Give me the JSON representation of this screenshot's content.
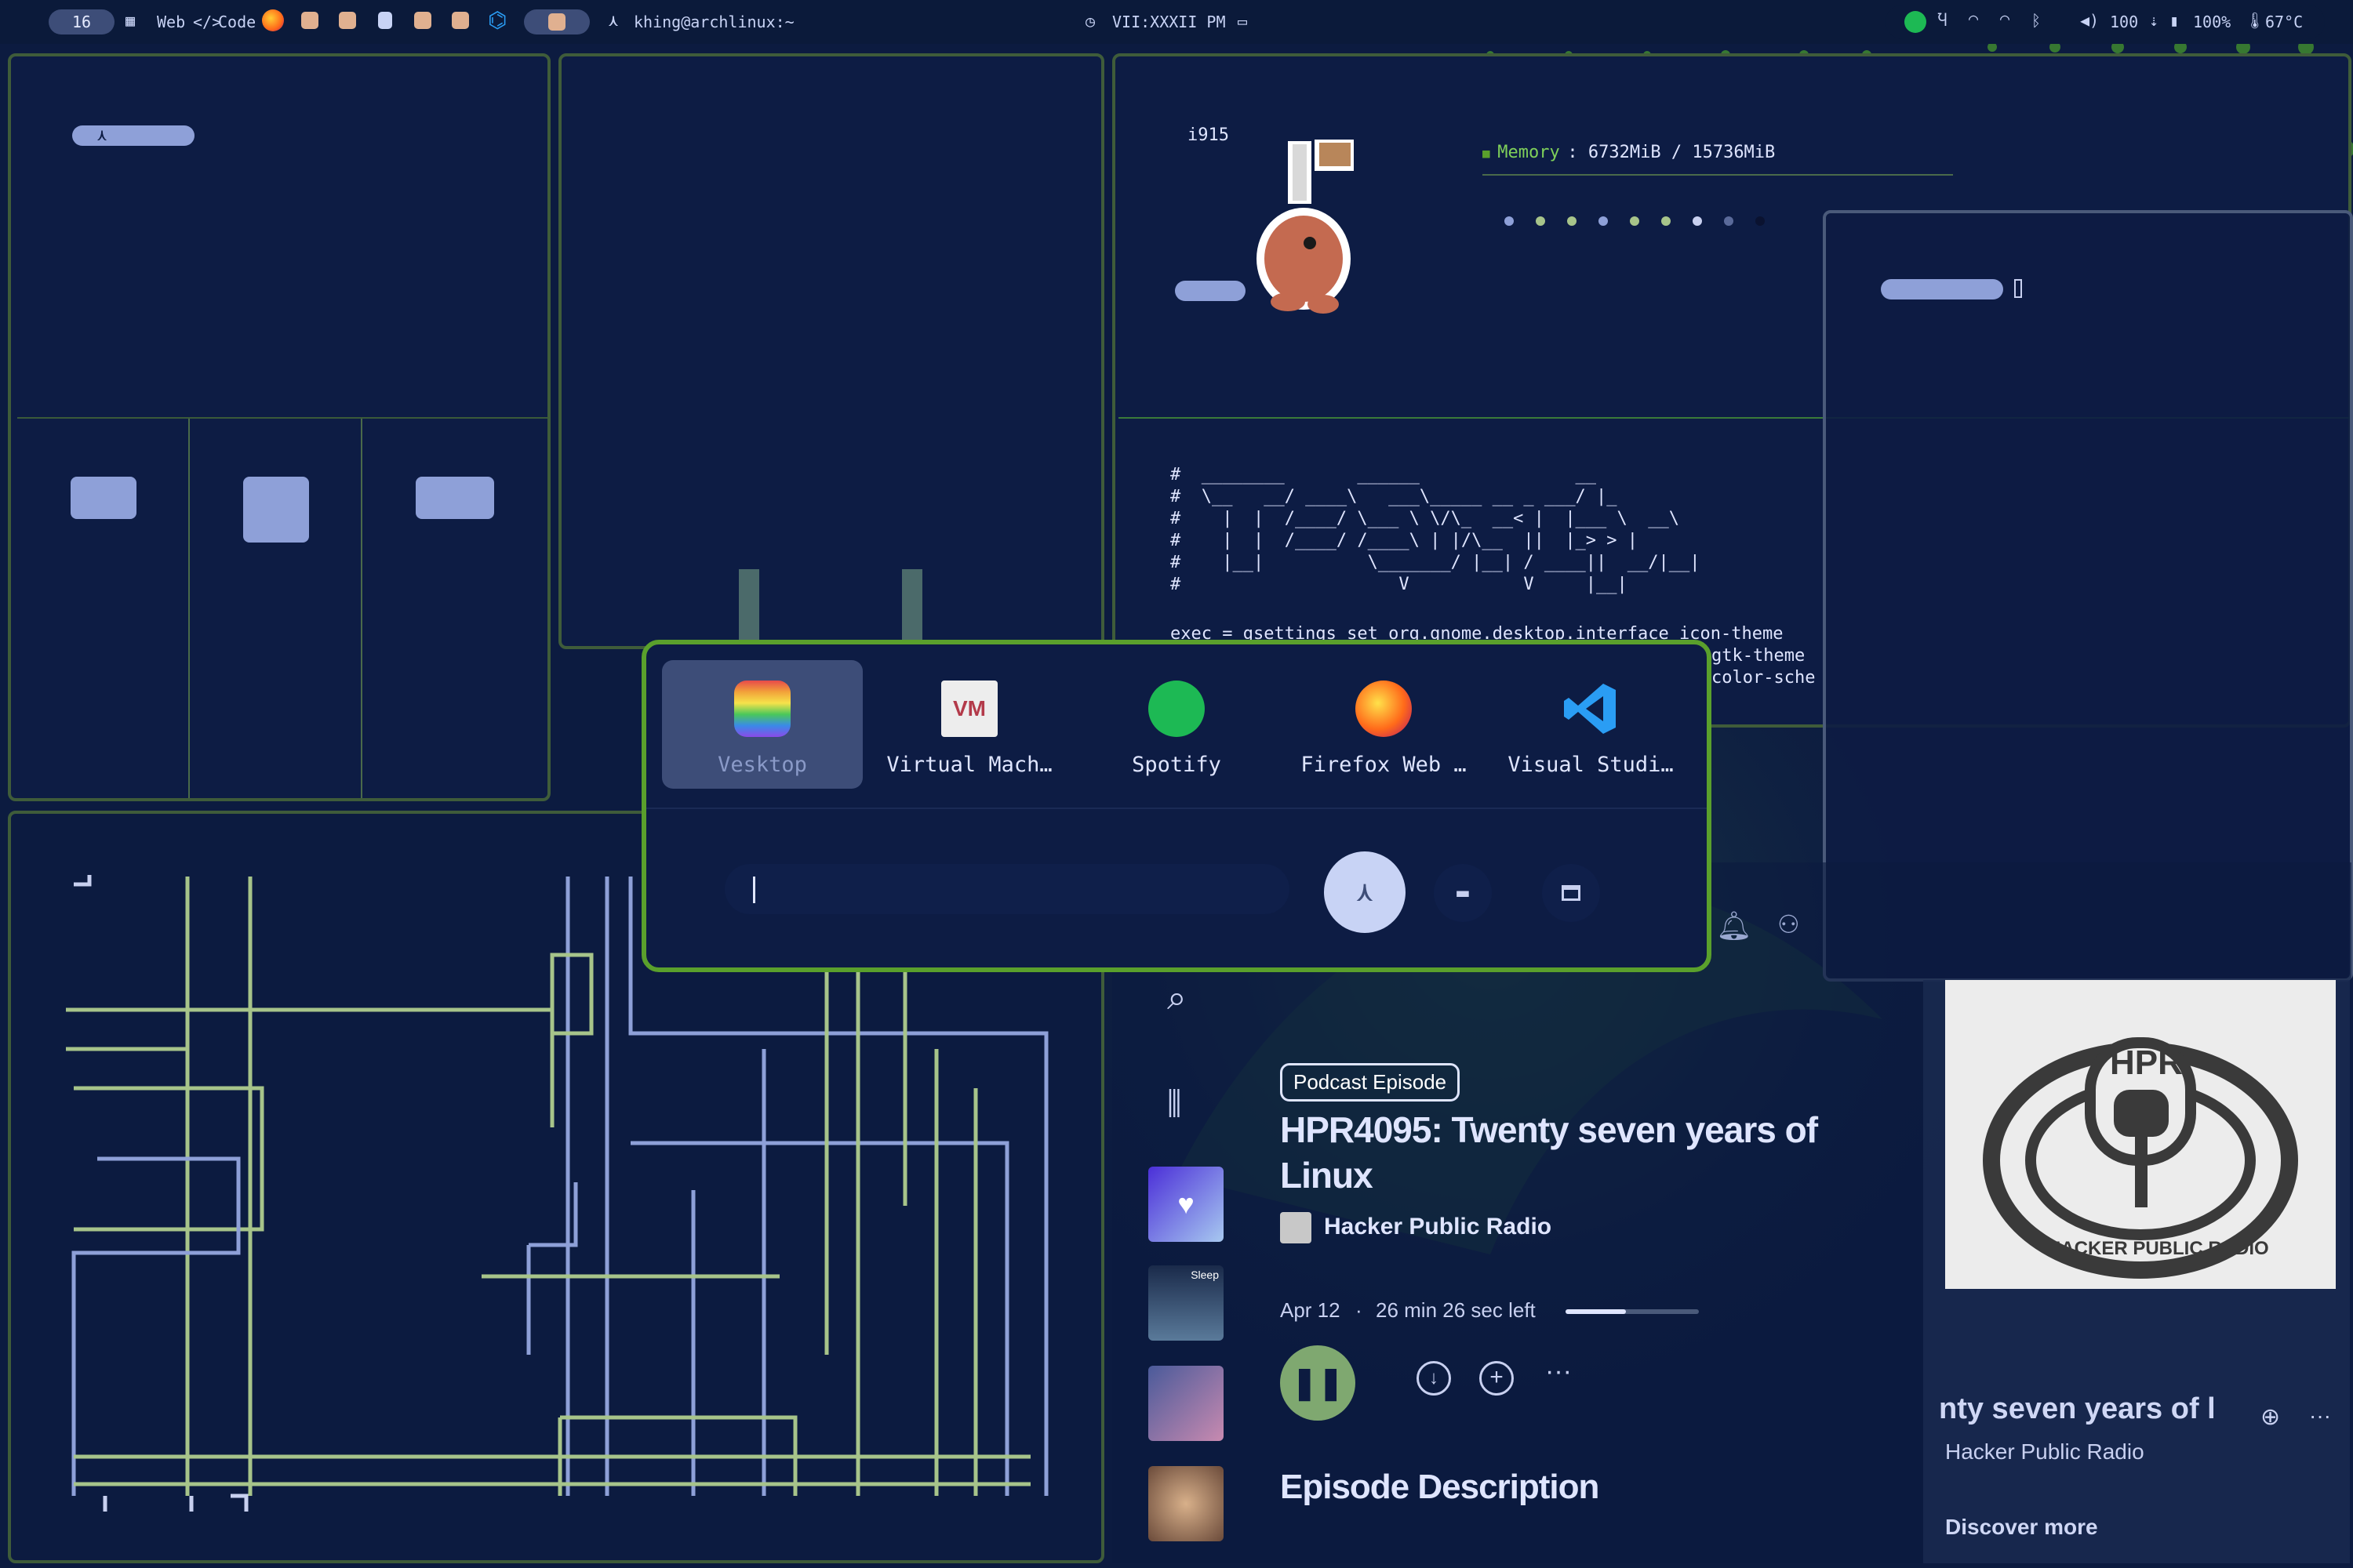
{
  "topbar": {
    "workspace": "16",
    "web_label": "Web",
    "code_label": "Code",
    "user_host": "khing@archlinux:~",
    "clock": "VII:XXXII PM",
    "volume": "100",
    "battery": "100%",
    "temperature": "67°C"
  },
  "sysinfo": {
    "gpu_prefix": "i915",
    "memory_label": "Memory",
    "memory_value": ": 6732MiB / 15736MiB"
  },
  "config_text": {
    "ascii_lines": [
      "#  ________       ______               __",
      "#  \\__   __/ ____\\   ___\\_____ __ _ ___/ |_",
      "#    |  |  /____/ \\___ \\ \\/\\_  __< |  |___ \\  __\\",
      "#    |  |  /____/ /____\\ | |/\\__  ||  |_> > |",
      "#    |__|          \\_______/ |__| / ____||  __/|__|",
      "#                     V           V     |__|"
    ],
    "exec_line": "exec = gsettings set org.gnome.desktop.interface icon-theme",
    "gtk_line": "gtk-theme",
    "color_line": "color-sche"
  },
  "launcher": {
    "apps": [
      {
        "label": "Vesktop",
        "selected": true
      },
      {
        "label": "Virtual Mach…",
        "selected": false
      },
      {
        "label": "Spotify",
        "selected": false
      },
      {
        "label": "Firefox Web …",
        "selected": false
      },
      {
        "label": "Visual Studi…",
        "selected": false
      }
    ],
    "search_value": "",
    "buttons": [
      "arch-icon",
      "folder-icon",
      "window-icon"
    ]
  },
  "spotify": {
    "badge": "Podcast Episode",
    "title": "HPR4095: Twenty seven years of Linux",
    "show": "Hacker Public Radio",
    "date": "Apr 12",
    "separator": "·",
    "time_left": "26 min 26 sec left",
    "progress": 0.45,
    "section_heading": "Episode Description",
    "sidebar_thumb_label": "Sleep",
    "nowplaying_title": "nty seven years of l",
    "nowplaying_artist": "Hacker Public Radio",
    "discover": "Discover more",
    "cover_text_top": "HPR",
    "cover_text_ring": "HACKER PUBLIC RADIO"
  },
  "colors": {
    "accent_green": "#5aa02c",
    "spotify_green": "#1db954",
    "play_button": "#7fa870",
    "bg": "#0c1b40"
  }
}
